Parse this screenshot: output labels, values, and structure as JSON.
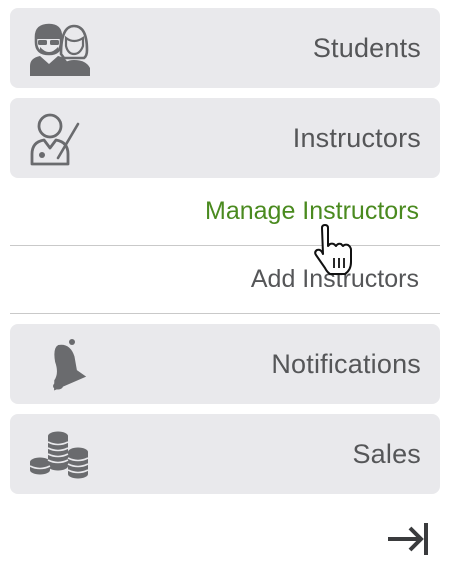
{
  "menu": {
    "students": {
      "label": "Students",
      "icon": "students-icon"
    },
    "instructors": {
      "label": "Instructors",
      "icon": "instructor-icon"
    },
    "instructors_submenu": [
      {
        "label": "Manage Instructors",
        "state": "active"
      },
      {
        "label": "Add Instructors",
        "state": "inactive"
      }
    ],
    "notifications": {
      "label": "Notifications",
      "icon": "bell-icon"
    },
    "sales": {
      "label": "Sales",
      "icon": "coins-icon"
    }
  },
  "collapse": {
    "icon": "collapse-sidebar-icon"
  },
  "colors": {
    "item_bg": "#e9e9ec",
    "text": "#555658",
    "active_text": "#4a8a1f",
    "icon": "#6a6b6e"
  }
}
